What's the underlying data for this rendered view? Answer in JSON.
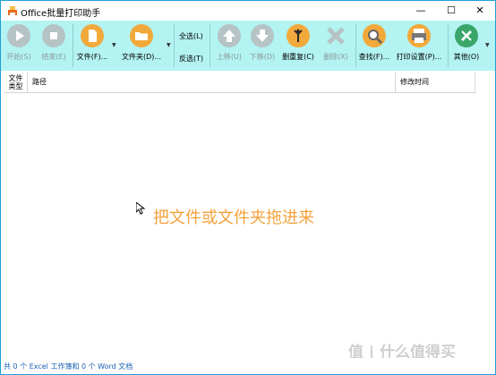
{
  "window": {
    "title": "Office批量打印助手",
    "minimize": "—",
    "maximize": "☐",
    "close": "✕"
  },
  "toolbar": {
    "start": "开始(S)",
    "stop": "结束(E)",
    "file": "文件(F)...",
    "folder": "文件夹(D)...",
    "select_all": "全选(L)",
    "invert": "反选(T)",
    "move_up": "上移(U)",
    "move_down": "下移(D)",
    "dedupe": "删重复(C)",
    "delete": "删除(X)",
    "find": "查找(F)...",
    "print_settings": "打印设置(P)...",
    "other": "其他(O)"
  },
  "table": {
    "columns": [
      "文件\n类型",
      "路径",
      "修改时间"
    ]
  },
  "drop_hint": "把文件或文件夹拖进来",
  "status": "共 0 个 Excel 工作簿和 0 个 Word 文档",
  "watermark": "值 | 什么值得买",
  "colors": {
    "toolbar_bg": "#b3f3f2",
    "hint": "#f4a23c",
    "status": "#1a5fb4"
  }
}
